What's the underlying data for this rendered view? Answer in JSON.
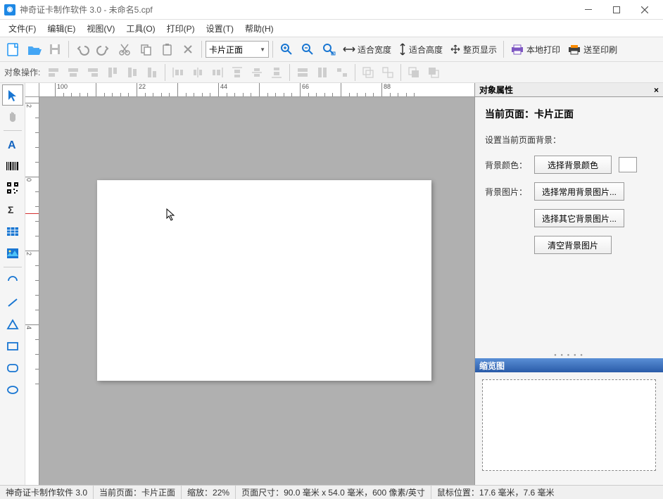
{
  "title": "神奇证卡制作软件 3.0 - 未命名5.cpf",
  "menu": {
    "file": "文件(F)",
    "edit": "编辑(E)",
    "view": "视图(V)",
    "tools": "工具(O)",
    "print": "打印(P)",
    "settings": "设置(T)",
    "help": "帮助(H)"
  },
  "toolbar": {
    "side_select": "卡片正面",
    "fit_width": "适合宽度",
    "fit_height": "适合高度",
    "full_page": "整页显示",
    "local_print": "本地打印",
    "send_print": "送至印刷"
  },
  "toolbar2_label": "对象操作:",
  "ruler_h": [
    "100",
    "-",
    "22",
    "-",
    "44",
    "-",
    "66",
    "-",
    "88"
  ],
  "ruler_v": [
    "2",
    "0",
    "2",
    "4"
  ],
  "props": {
    "panel_title": "对象属性",
    "current_page_label": "当前页面：",
    "current_page_value": "卡片正面",
    "set_bg_label": "设置当前页面背景：",
    "bg_color_label": "背景颜色：",
    "bg_color_btn": "选择背景颜色",
    "bg_image_label": "背景图片：",
    "bg_image_btn1": "选择常用背景图片...",
    "bg_image_btn2": "选择其它背景图片...",
    "bg_image_clear": "清空背景图片"
  },
  "thumb_title": "缩览图",
  "status": {
    "app": "神奇证卡制作软件 3.0",
    "page": "当前页面：卡片正面",
    "zoom": "缩放：22%",
    "size": "页面尺寸：90.0 毫米 x 54.0 毫米，600 像素/英寸",
    "mouse": "鼠标位置：17.6 毫米，7.6 毫米"
  }
}
